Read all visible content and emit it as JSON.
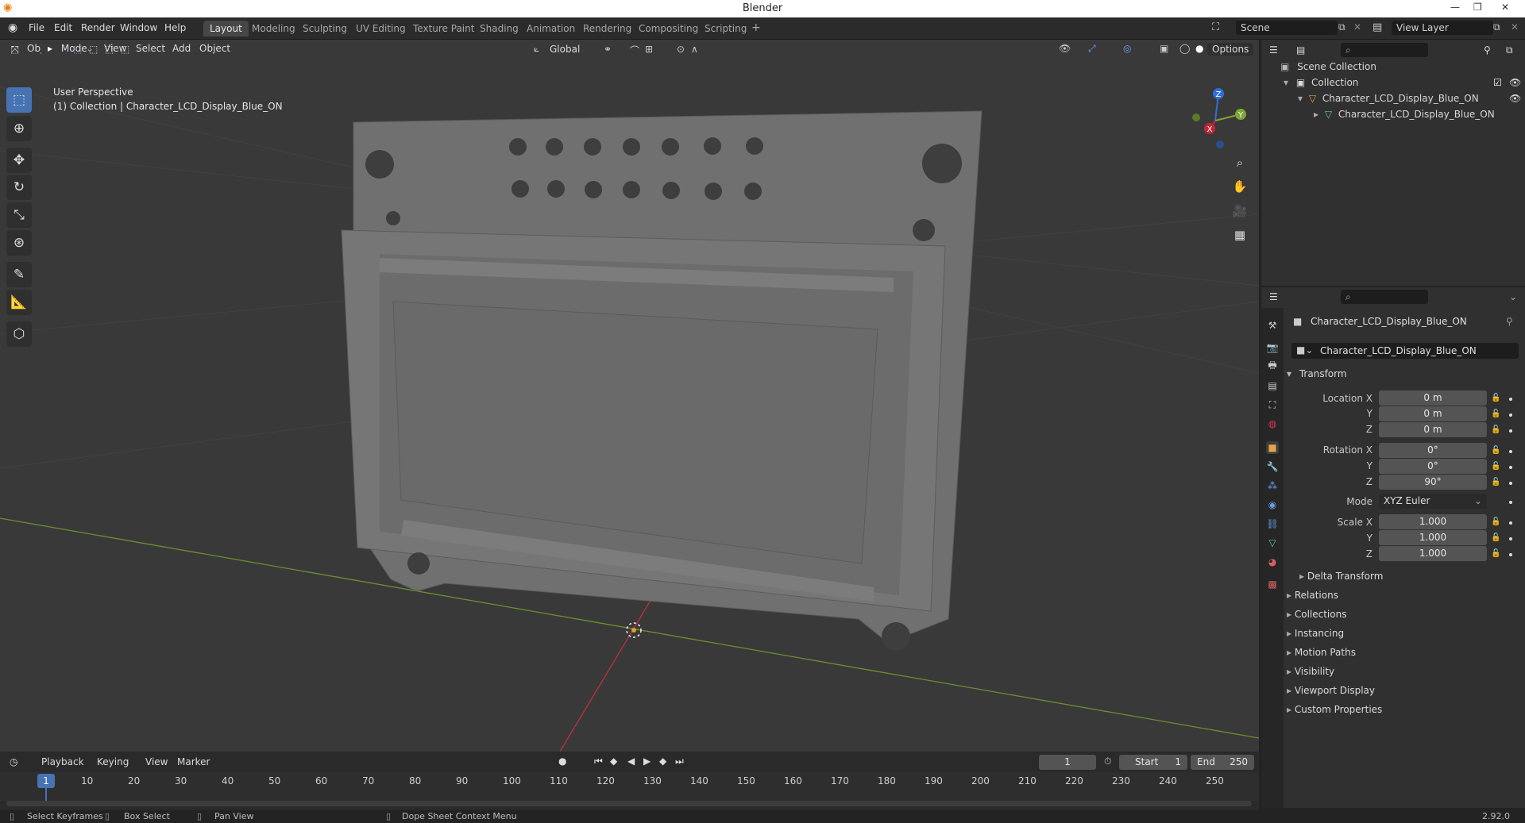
{
  "window": {
    "title": "Blender",
    "version": "2.92.0"
  },
  "menu": [
    "File",
    "Edit",
    "Render",
    "Window",
    "Help"
  ],
  "workspaces": [
    "Layout",
    "Modeling",
    "Sculpting",
    "UV Editing",
    "Texture Paint",
    "Shading",
    "Animation",
    "Rendering",
    "Compositing",
    "Scripting"
  ],
  "active_workspace": "Layout",
  "scene": {
    "scene_name": "Scene",
    "view_layer": "View Layer"
  },
  "viewport": {
    "mode": "Object Mode",
    "header_menus": [
      "View",
      "Select",
      "Add",
      "Object"
    ],
    "transform_orientation": "Global",
    "options_label": "Options",
    "overlay_title": "User Perspective",
    "overlay_subtitle": "(1) Collection | Character_LCD_Display_Blue_ON",
    "gizmo": {
      "x": "X",
      "y": "Y",
      "z": "Z"
    }
  },
  "outliner": {
    "scene_collection": "Scene Collection",
    "collection": "Collection",
    "object": "Character_LCD_Display_Blue_ON",
    "mesh": "Character_LCD_Display_Blue_ON"
  },
  "properties": {
    "object_name": "Character_LCD_Display_Blue_ON",
    "object_field": "Character_LCD_Display_Blue_ON",
    "transform_header": "Transform",
    "location_label": "Location X",
    "location": [
      "0 m",
      "0 m",
      "0 m"
    ],
    "rotation_label": "Rotation X",
    "rotation": [
      "0°",
      "0°",
      "90°"
    ],
    "mode_label": "Mode",
    "mode_value": "XYZ Euler",
    "scale_label": "Scale X",
    "scale": [
      "1.000",
      "1.000",
      "1.000"
    ],
    "axis_y": "Y",
    "axis_z": "Z",
    "subpanels": [
      "Delta Transform",
      "Relations",
      "Collections",
      "Instancing",
      "Motion Paths",
      "Visibility",
      "Viewport Display",
      "Custom Properties"
    ]
  },
  "timeline": {
    "menus": [
      "Playback",
      "Keying",
      "View",
      "Marker"
    ],
    "current_frame": "1",
    "start_label": "Start",
    "start": "1",
    "end_label": "End",
    "end": "250",
    "ticks": [
      "1",
      "10",
      "20",
      "30",
      "40",
      "50",
      "60",
      "70",
      "80",
      "90",
      "100",
      "110",
      "120",
      "130",
      "140",
      "150",
      "160",
      "170",
      "180",
      "190",
      "200",
      "210",
      "220",
      "230",
      "240",
      "250"
    ]
  },
  "statusbar": [
    "Select Keyframes",
    "Box Select",
    "Pan View",
    "Dope Sheet Context Menu"
  ],
  "colors": {
    "accent": "#4772b3",
    "x_axis": "#c2283a",
    "y_axis": "#7fa533",
    "z_axis": "#2f6fd6",
    "mesh": "#6e6e6e"
  }
}
